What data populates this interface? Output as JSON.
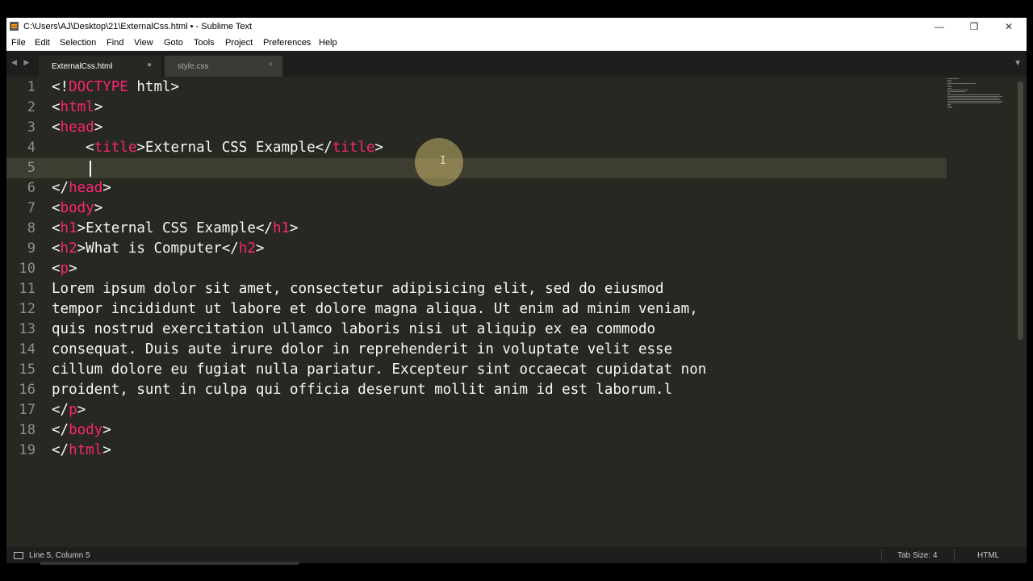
{
  "window": {
    "title": "C:\\Users\\AJ\\Desktop\\21\\ExternalCss.html • - Sublime Text"
  },
  "menu": [
    "File",
    "Edit",
    "Selection",
    "Find",
    "View",
    "Goto",
    "Tools",
    "Project",
    "Preferences",
    "Help"
  ],
  "tabs": [
    {
      "label": "ExternalCss.html",
      "state": "modified-dot"
    },
    {
      "label": "style.css",
      "state": "close-x"
    }
  ],
  "tab_controls": {
    "modified": "●",
    "close": "×",
    "nav": "◀ ▶",
    "menu": "▼"
  },
  "window_controls": {
    "minimize": "—",
    "restore": "❐",
    "close": "✕"
  },
  "editor": {
    "line_numbers": [
      "1",
      "2",
      "3",
      "4",
      "5",
      "6",
      "7",
      "8",
      "9",
      "10",
      "11",
      "12",
      "13",
      "14",
      "15",
      "16",
      "17",
      "18",
      "19"
    ],
    "active_line": 5,
    "lines": [
      [
        {
          "t": "<!"
        },
        {
          "t": "DOCTYPE",
          "c": "tag"
        },
        {
          "t": " html>"
        }
      ],
      [
        {
          "t": "<"
        },
        {
          "t": "html",
          "c": "tag"
        },
        {
          "t": ">"
        }
      ],
      [
        {
          "t": "<"
        },
        {
          "t": "head",
          "c": "tag"
        },
        {
          "t": ">"
        }
      ],
      [
        {
          "t": "    <"
        },
        {
          "t": "title",
          "c": "tag"
        },
        {
          "t": ">External CSS Example</"
        },
        {
          "t": "title",
          "c": "tag"
        },
        {
          "t": ">"
        }
      ],
      [
        {
          "t": "    "
        }
      ],
      [
        {
          "t": "</"
        },
        {
          "t": "head",
          "c": "tag"
        },
        {
          "t": ">"
        }
      ],
      [
        {
          "t": "<"
        },
        {
          "t": "body",
          "c": "tag"
        },
        {
          "t": ">"
        }
      ],
      [
        {
          "t": "<"
        },
        {
          "t": "h1",
          "c": "tag"
        },
        {
          "t": ">External CSS Example</"
        },
        {
          "t": "h1",
          "c": "tag"
        },
        {
          "t": ">"
        }
      ],
      [
        {
          "t": "<"
        },
        {
          "t": "h2",
          "c": "tag"
        },
        {
          "t": ">What is Computer</"
        },
        {
          "t": "h2",
          "c": "tag"
        },
        {
          "t": ">"
        }
      ],
      [
        {
          "t": "<"
        },
        {
          "t": "p",
          "c": "tag"
        },
        {
          "t": ">"
        }
      ],
      [
        {
          "t": "Lorem ipsum dolor sit amet, consectetur adipisicing elit, sed do eiusmod"
        }
      ],
      [
        {
          "t": "tempor incididunt ut labore et dolore magna aliqua. Ut enim ad minim veniam,"
        }
      ],
      [
        {
          "t": "quis nostrud exercitation ullamco laboris nisi ut aliquip ex ea commodo"
        }
      ],
      [
        {
          "t": "consequat. Duis aute irure dolor in reprehenderit in voluptate velit esse"
        }
      ],
      [
        {
          "t": "cillum dolore eu fugiat nulla pariatur. Excepteur sint occaecat cupidatat non"
        }
      ],
      [
        {
          "t": "proident, sunt in culpa qui officia deserunt mollit anim id est laborum.l"
        }
      ],
      [
        {
          "t": "</"
        },
        {
          "t": "p",
          "c": "tag"
        },
        {
          "t": ">"
        }
      ],
      [
        {
          "t": "</"
        },
        {
          "t": "body",
          "c": "tag"
        },
        {
          "t": ">"
        }
      ],
      [
        {
          "t": "</"
        },
        {
          "t": "html",
          "c": "tag"
        },
        {
          "t": ">"
        }
      ]
    ]
  },
  "status": {
    "position": "Line 5, Column 5",
    "tab_size": "Tab Size: 4",
    "syntax": "HTML"
  },
  "colors": {
    "background": "#272822",
    "tag": "#f92672",
    "text": "#f8f8f2",
    "line_number": "#90908a",
    "active_line": "#3e3d32"
  }
}
